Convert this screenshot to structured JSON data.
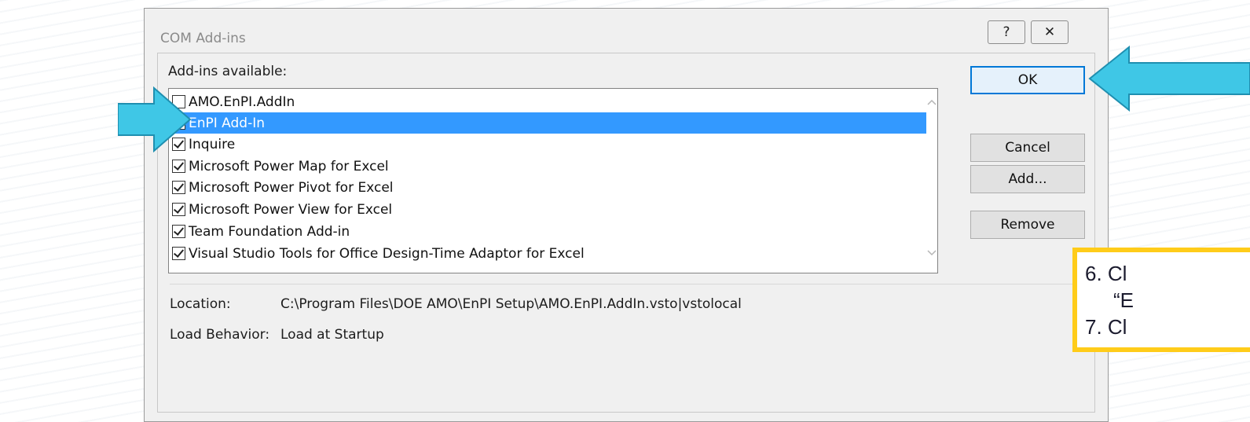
{
  "dialog": {
    "title": "COM Add-ins",
    "help_glyph": "?",
    "close_glyph": "✕"
  },
  "addins": {
    "heading": "Add-ins available:",
    "items": [
      {
        "label": "AMO.EnPI.AddIn",
        "checked": false,
        "selected": false
      },
      {
        "label": "EnPI Add-In",
        "checked": true,
        "selected": true
      },
      {
        "label": "Inquire",
        "checked": true,
        "selected": false
      },
      {
        "label": "Microsoft Power Map for Excel",
        "checked": true,
        "selected": false
      },
      {
        "label": "Microsoft Power Pivot for Excel",
        "checked": true,
        "selected": false
      },
      {
        "label": "Microsoft Power View for Excel",
        "checked": true,
        "selected": false
      },
      {
        "label": "Team Foundation Add-in",
        "checked": true,
        "selected": false
      },
      {
        "label": "Visual Studio Tools for Office Design-Time Adaptor for Excel",
        "checked": true,
        "selected": false
      }
    ]
  },
  "buttons": {
    "ok": "OK",
    "cancel": "Cancel",
    "add": "Add...",
    "remove": "Remove"
  },
  "details": {
    "location_label": "Location:",
    "location_value": "C:\\Program Files\\DOE AMO\\EnPI Setup\\AMO.EnPI.AddIn.vsto|vstolocal",
    "load_behavior_label": "Load Behavior:",
    "load_behavior_value": "Load at Startup"
  },
  "instructions": {
    "line1": "6.  Cl",
    "line2": "“E",
    "line3": "7.  Cl"
  },
  "colors": {
    "arrow": "#3fc7e6",
    "selection": "#3399ff",
    "callout_border": "#ffcc1a"
  }
}
